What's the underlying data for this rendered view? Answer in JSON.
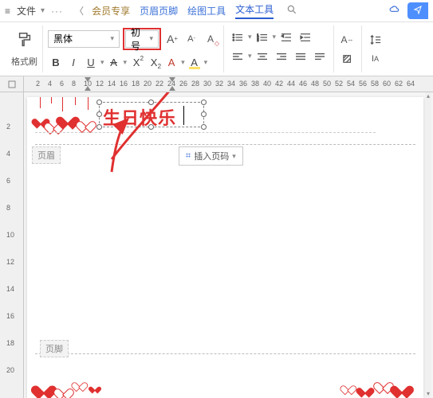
{
  "menubar": {
    "file": "文件",
    "member": "会员专享",
    "header_footer": "页眉页脚",
    "draw_tools": "绘图工具",
    "text_tools": "文本工具"
  },
  "ribbon": {
    "brush_label": "格式刷",
    "font_name": "黑体",
    "font_size": "初号",
    "bold": "B",
    "italic": "I",
    "underline": "U",
    "strike": "A",
    "super": "X",
    "sub": "X",
    "color_a": "A",
    "highlight_a": "A",
    "clear_fmt": "A"
  },
  "ruler": {
    "h": [
      "",
      "2",
      "4",
      "6",
      "8",
      "10",
      "12",
      "14",
      "16",
      "18",
      "20",
      "22",
      "24",
      "26",
      "28",
      "30",
      "32",
      "34",
      "36",
      "38",
      "40",
      "42",
      "44",
      "46",
      "48",
      "50",
      "52",
      "54",
      "56",
      "58",
      "60",
      "62",
      "64"
    ],
    "v": [
      "",
      "2",
      "4",
      "6",
      "8",
      "10",
      "12",
      "14",
      "16",
      "18",
      "20"
    ]
  },
  "document": {
    "main_text": "生日快乐",
    "header_label": "页眉",
    "footer_label": "页脚",
    "insert_page_number": "插入页码"
  }
}
